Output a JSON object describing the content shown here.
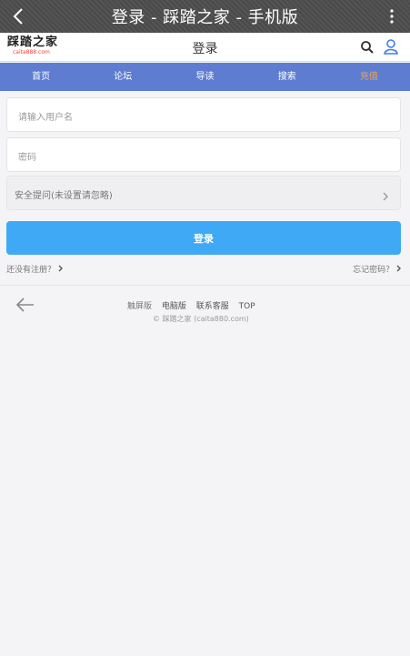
{
  "browser": {
    "title": "登录 - 踩踏之家 - 手机版"
  },
  "header": {
    "logo_main": "踩踏之家",
    "logo_sub": "caita888.com",
    "page_title": "登录"
  },
  "nav": {
    "items": [
      "首页",
      "论坛",
      "导读",
      "搜索",
      "充值"
    ]
  },
  "form": {
    "username_placeholder": "请输入用户名",
    "password_placeholder": "密码",
    "security_question": "安全提问(未设置请忽略)",
    "submit_label": "登录"
  },
  "links": {
    "register": "还没有注册？",
    "forgot": "忘记密码？"
  },
  "footer": {
    "links": [
      "触屏版",
      "电脑版",
      "联系客服",
      "TOP"
    ],
    "copyright": "© 踩踏之家 (caita880.com)"
  },
  "colors": {
    "nav_bg": "#5e7dd0",
    "recharge_text": "#f1a54a",
    "primary_button": "#3fa9f5",
    "user_icon": "#3c7df5"
  }
}
